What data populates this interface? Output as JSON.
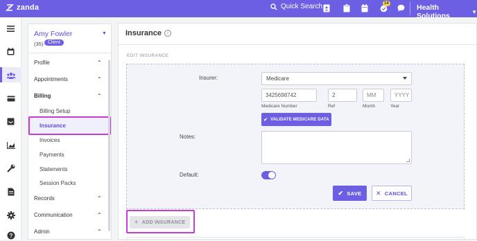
{
  "topbar": {
    "logo_text": "zanda",
    "quick_search_label": "Quick Search",
    "notification_count": "14",
    "org_name": "Health Solutions",
    "icons": [
      "search-icon",
      "contacts-icon",
      "clipboard-icon",
      "calendar-icon",
      "tasks-icon",
      "chat-icon",
      "chevron-down-icon"
    ],
    "accent_color": "#6d5fe4"
  },
  "rail": {
    "icons": [
      "menu-icon",
      "calendar-icon",
      "clients-icon",
      "billing-icon",
      "inbox-icon",
      "reports-icon",
      "tools-icon",
      "document-icon",
      "settings-icon",
      "help-icon"
    ],
    "active": "clients-icon"
  },
  "client": {
    "name": "Amy Fowler",
    "age": "(35)",
    "badge": "Client"
  },
  "nav": {
    "profile": "Profile",
    "appointments": "Appointments",
    "billing": "Billing",
    "billing_items": [
      "Billing Setup",
      "Insurance",
      "Invoices",
      "Payments",
      "Statements",
      "Session Packs"
    ],
    "active_item": "Insurance",
    "records": "Records",
    "communication": "Communication",
    "admin": "Admin"
  },
  "main": {
    "title": "Insurance",
    "section_label": "EDIT INSURANCE",
    "insurer_label": "Insurer:",
    "insurer_value": "Medicare",
    "medicare_number_value": "3425698742",
    "medicare_number_label": "Medicare Number",
    "ref_value": "2",
    "ref_label": "Ref",
    "month_placeholder": "MM",
    "month_label": "Month",
    "year_placeholder": "YYYY",
    "year_label": "Year",
    "validate_label": "VALIDATE MEDICARE DATA",
    "notes_label": "Notes:",
    "notes_value": "",
    "default_label": "Default:",
    "default_on": true,
    "save_label": "SAVE",
    "cancel_label": "CANCEL",
    "add_insurance_label": "ADD INSURANCE"
  }
}
